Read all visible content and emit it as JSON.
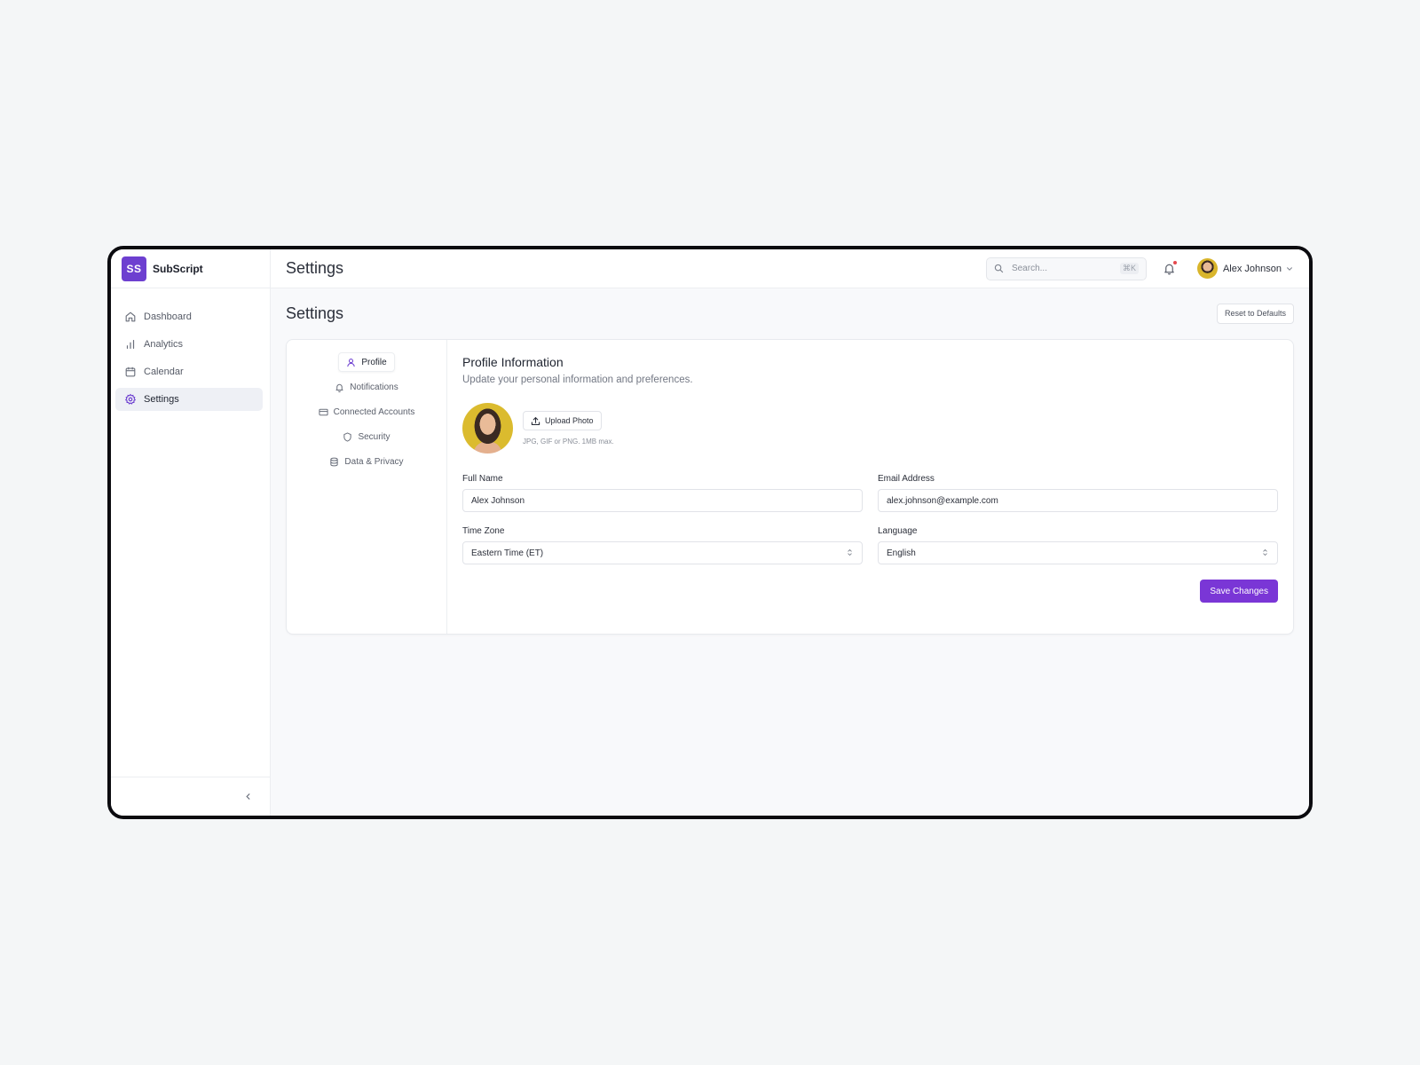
{
  "brand": {
    "logo_text": "SS",
    "name": "SubScript",
    "color": "#6d3fd0"
  },
  "sidebar": {
    "items": [
      {
        "label": "Dashboard",
        "icon": "home-icon",
        "active": false
      },
      {
        "label": "Analytics",
        "icon": "bar-chart-icon",
        "active": false
      },
      {
        "label": "Calendar",
        "icon": "calendar-icon",
        "active": false
      },
      {
        "label": "Settings",
        "icon": "gear-icon",
        "active": true
      }
    ],
    "collapse_icon": "chevron-left-icon"
  },
  "topbar": {
    "title": "Settings",
    "search": {
      "placeholder": "Search...",
      "shortcut": "⌘K"
    },
    "notifications": {
      "has_unread": true,
      "dot_color": "#e5484d"
    },
    "user": {
      "name": "Alex Johnson"
    }
  },
  "page": {
    "title": "Settings",
    "reset_label": "Reset to Defaults"
  },
  "settings_tabs": [
    {
      "label": "Profile",
      "icon": "user-icon",
      "active": true
    },
    {
      "label": "Notifications",
      "icon": "bell-icon",
      "active": false
    },
    {
      "label": "Connected Accounts",
      "icon": "credit-card-icon",
      "active": false
    },
    {
      "label": "Security",
      "icon": "shield-icon",
      "active": false
    },
    {
      "label": "Data & Privacy",
      "icon": "database-icon",
      "active": false
    }
  ],
  "profile": {
    "title": "Profile Information",
    "subtitle": "Update your personal information and preferences.",
    "upload_label": "Upload Photo",
    "upload_hint": "JPG, GIF or PNG. 1MB max.",
    "fields": {
      "full_name": {
        "label": "Full Name",
        "value": "Alex Johnson"
      },
      "email": {
        "label": "Email Address",
        "value": "alex.johnson@example.com"
      },
      "time_zone": {
        "label": "Time Zone",
        "value": "Eastern Time (ET)"
      },
      "language": {
        "label": "Language",
        "value": "English"
      }
    },
    "save_label": "Save Changes",
    "accent_color": "#7a36d6"
  }
}
